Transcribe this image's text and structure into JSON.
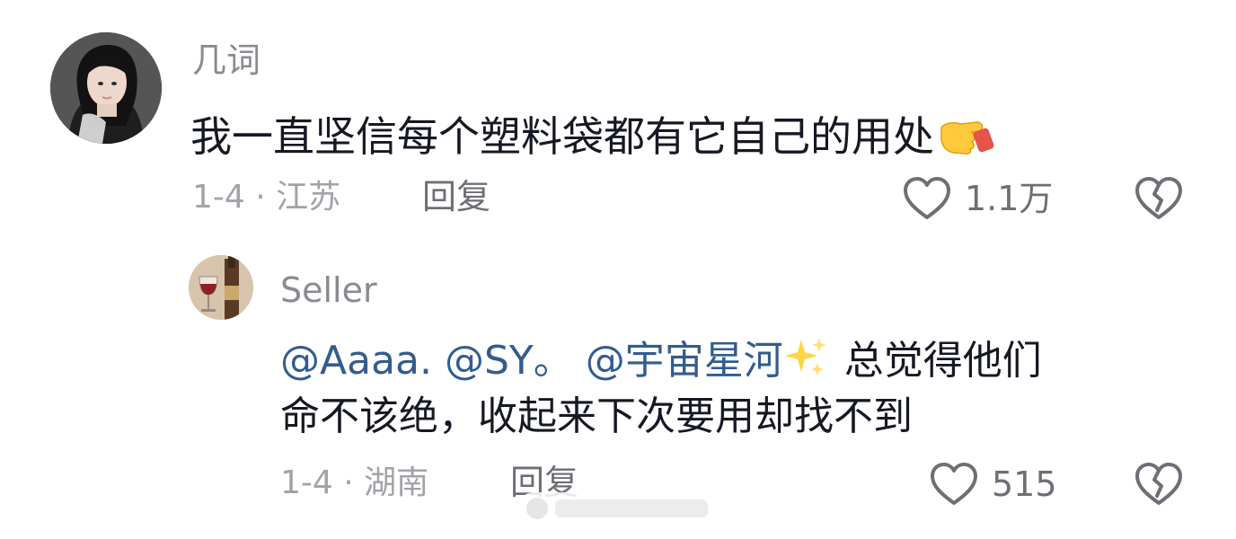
{
  "comment": {
    "username": "几词",
    "text": "我一直坚信每个塑料袋都有它自己的用处",
    "emoji_icon": "pointing-hand-emoji",
    "meta": "1-4 · 江苏",
    "reply_label": "回复",
    "like_count": "1.1万"
  },
  "reply": {
    "username": "Seller",
    "mention1": "@Aaaa.",
    "mention2": "@SY。",
    "mention3": "@宇宙星河",
    "sparkle_icon": "sparkles-emoji",
    "text_after_mentions": "总觉得他们",
    "text_line2": "命不该绝，收起来下次要用却找不到",
    "meta": "1-4 · 湖南",
    "reply_label": "回复",
    "like_count": "515"
  },
  "colors": {
    "text": "#161823",
    "username": "#8a8b91",
    "meta": "#a2a3a8",
    "mention": "#335c8e",
    "icon": "#6e6f75"
  }
}
